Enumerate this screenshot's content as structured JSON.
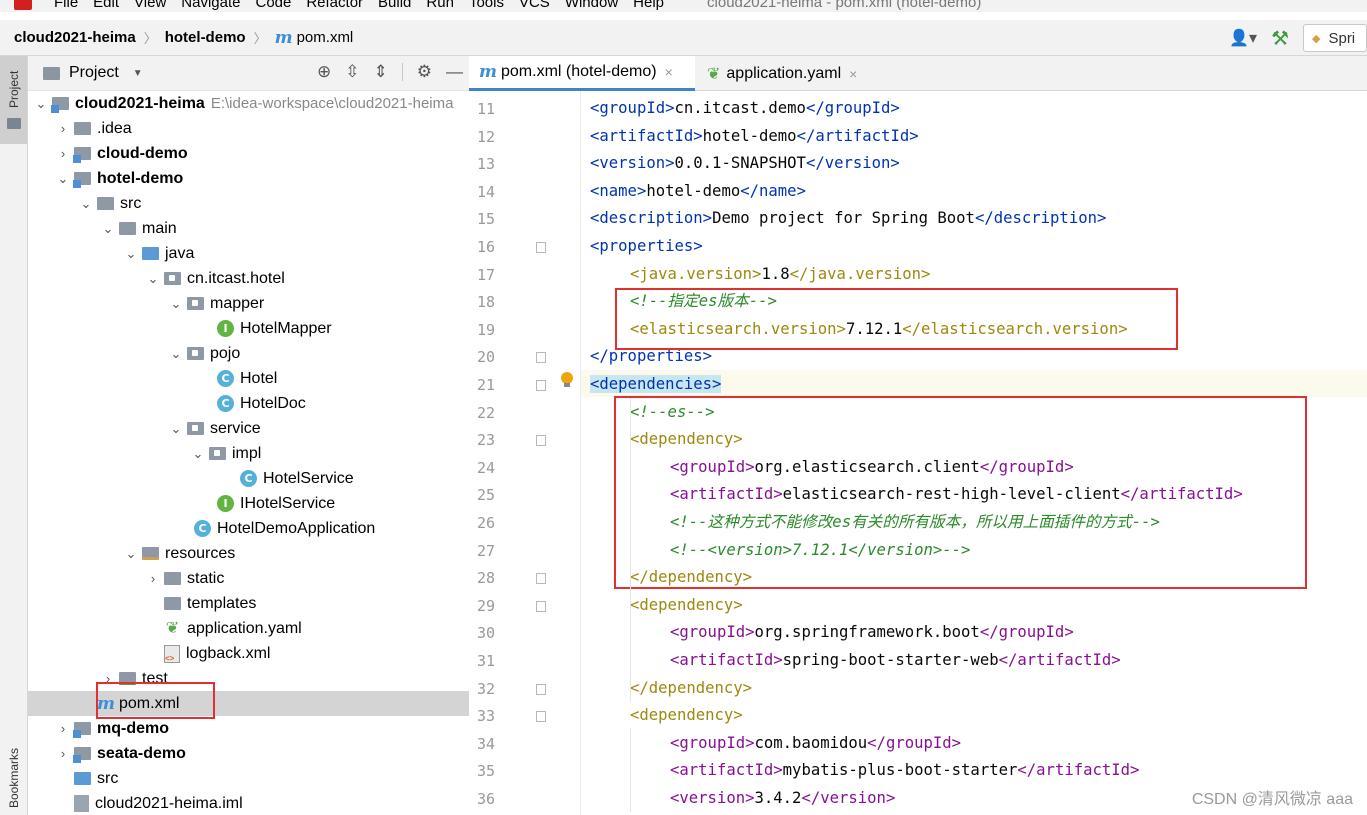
{
  "menu": {
    "items": [
      "File",
      "Edit",
      "View",
      "Navigate",
      "Code",
      "Refactor",
      "Build",
      "Run",
      "Tools",
      "VCS",
      "Window",
      "Help"
    ],
    "window_title": "cloud2021-heima - pom.xml (hotel-demo)"
  },
  "breadcrumb": {
    "root": "cloud2021-heima",
    "module": "hotel-demo",
    "file": "pom.xml"
  },
  "toolbar": {
    "run_config": "Spri"
  },
  "toolstrip": {
    "project_label": "Project",
    "bookmarks_label": "Bookmarks"
  },
  "project_panel": {
    "title": "Project",
    "tree": [
      {
        "label": "cloud2021-heima",
        "path": "E:\\idea-workspace\\cloud2021-heima"
      },
      {
        "label": ".idea"
      },
      {
        "label": "cloud-demo"
      },
      {
        "label": "hotel-demo"
      },
      {
        "label": "src"
      },
      {
        "label": "main"
      },
      {
        "label": "java"
      },
      {
        "label": "cn.itcast.hotel"
      },
      {
        "label": "mapper"
      },
      {
        "label": "HotelMapper"
      },
      {
        "label": "pojo"
      },
      {
        "label": "Hotel"
      },
      {
        "label": "HotelDoc"
      },
      {
        "label": "service"
      },
      {
        "label": "impl"
      },
      {
        "label": "HotelService"
      },
      {
        "label": "IHotelService"
      },
      {
        "label": "HotelDemoApplication"
      },
      {
        "label": "resources"
      },
      {
        "label": "static"
      },
      {
        "label": "templates"
      },
      {
        "label": "application.yaml"
      },
      {
        "label": "logback.xml"
      },
      {
        "label": "test"
      },
      {
        "label": "pom.xml"
      },
      {
        "label": "mq-demo"
      },
      {
        "label": "seata-demo"
      },
      {
        "label": "src"
      },
      {
        "label": "cloud2021-heima.iml"
      }
    ]
  },
  "tabs": [
    {
      "label": "pom.xml (hotel-demo)",
      "active": true
    },
    {
      "label": "application.yaml",
      "active": false
    }
  ],
  "editor": {
    "line_numbers": [
      "11",
      "12",
      "13",
      "14",
      "15",
      "16",
      "17",
      "18",
      "19",
      "20",
      "21",
      "22",
      "23",
      "24",
      "25",
      "26",
      "27",
      "28",
      "29",
      "30",
      "31",
      "32",
      "33",
      "34",
      "35",
      "36"
    ],
    "lines": [
      {
        "open": "<groupId>",
        "text": "cn.itcast.demo",
        "close": "</groupId>"
      },
      {
        "open": "<artifactId>",
        "text": "hotel-demo",
        "close": "</artifactId>"
      },
      {
        "open": "<version>",
        "text": "0.0.1-SNAPSHOT",
        "close": "</version>"
      },
      {
        "open": "<name>",
        "text": "hotel-demo",
        "close": "</name>"
      },
      {
        "open": "<description>",
        "text": "Demo project for Spring Boot",
        "close": "</description>"
      },
      {
        "open": "<properties>",
        "text": "",
        "close": ""
      },
      {
        "open": "<java.version>",
        "text": "1.8",
        "close": "</java.version>"
      },
      {
        "comment": "<!--指定es版本-->"
      },
      {
        "open": "<elasticsearch.version>",
        "text": "7.12.1",
        "close": "</elasticsearch.version>"
      },
      {
        "open": "",
        "text": "",
        "close": "</properties>"
      },
      {
        "open": "<dependencies>",
        "text": "",
        "close": ""
      },
      {
        "comment": "<!--es-->"
      },
      {
        "open": "<dependency>",
        "text": "",
        "close": ""
      },
      {
        "open": "<groupId>",
        "text": "org.elasticsearch.client",
        "close": "</groupId>"
      },
      {
        "open": "<artifactId>",
        "text": "elasticsearch-rest-high-level-client",
        "close": "</artifactId>"
      },
      {
        "comment": "<!--这种方式不能修改es有关的所有版本，所以用上面插件的方式-->"
      },
      {
        "comment": "<!--<version>7.12.1</version>-->"
      },
      {
        "open": "",
        "text": "",
        "close": "</dependency>"
      },
      {
        "open": "<dependency>",
        "text": "",
        "close": ""
      },
      {
        "open": "<groupId>",
        "text": "org.springframework.boot",
        "close": "</groupId>"
      },
      {
        "open": "<artifactId>",
        "text": "spring-boot-starter-web",
        "close": "</artifactId>"
      },
      {
        "open": "",
        "text": "",
        "close": "</dependency>"
      },
      {
        "open": "<dependency>",
        "text": "",
        "close": ""
      },
      {
        "open": "<groupId>",
        "text": "com.baomidou",
        "close": "</groupId>"
      },
      {
        "open": "<artifactId>",
        "text": "mybatis-plus-boot-starter",
        "close": "</artifactId>"
      },
      {
        "open": "<version>",
        "text": "3.4.2",
        "close": "</version>"
      }
    ]
  },
  "watermark": "CSDN @清风微凉 aaa"
}
